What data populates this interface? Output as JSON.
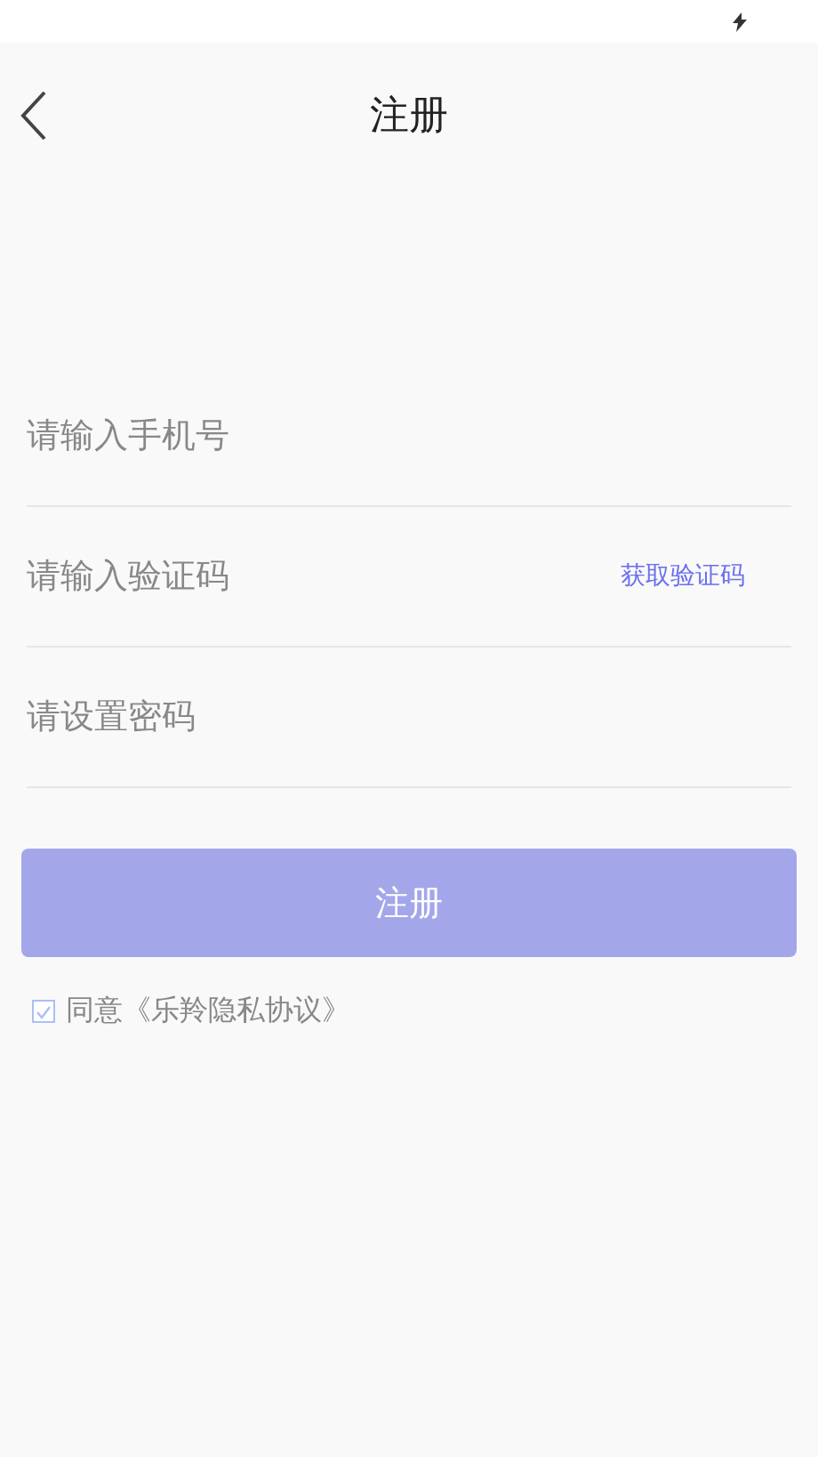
{
  "header": {
    "title": "注册"
  },
  "fields": [
    {
      "placeholder": "请输入手机号"
    },
    {
      "placeholder": "请输入验证码",
      "action": "获取验证码"
    },
    {
      "placeholder": "请设置密码"
    }
  ],
  "submit": {
    "label": "注册",
    "disabled": true
  },
  "agreement": {
    "checked": true,
    "text": "同意《乐羚隐私协议》"
  }
}
